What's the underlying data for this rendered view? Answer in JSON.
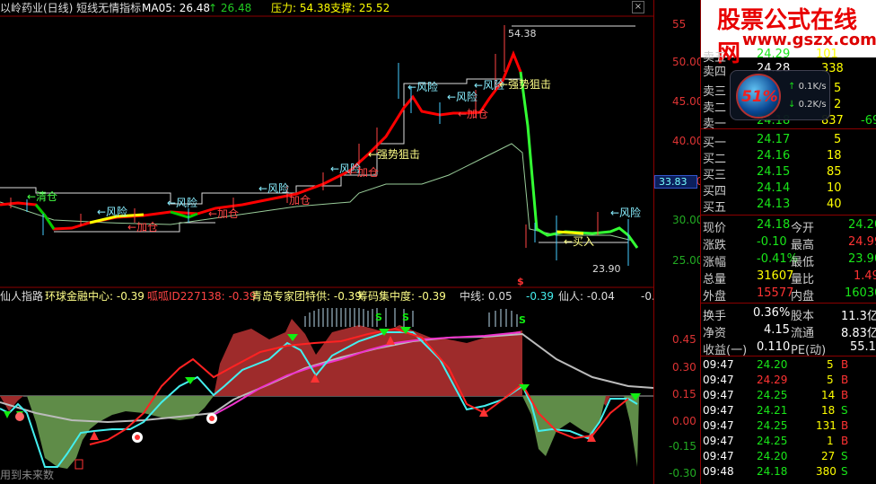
{
  "header": {
    "title": "以岭药业(日线) 短线无情指标",
    "ma_label": "MA05: 26.48",
    "ma_diff": "↑ 26.48",
    "pressure": "压力: 54.38",
    "support": "支撑: 25.52",
    "close_label": "×"
  },
  "main_chart": {
    "annotations": {
      "clear1": "←清仓",
      "risk1": "←风险",
      "add1": "←加仓",
      "risk2": "←风险",
      "add2": "←加仓",
      "risk3": "←风险",
      "add3": "←加仓",
      "add4": "加仓",
      "risk4": "←风险",
      "add5": "←加仓",
      "strong1": "←强势狙击",
      "risk5": "←风险",
      "add6": "←加仓",
      "risk6": "←风险",
      "strong2": "←强势狙击",
      "high": "54.38",
      "low": "23.90",
      "buy": "←买入",
      "risk7": "←风险",
      "s_mark": "S"
    },
    "price_ticks": [
      "55",
      "50.00",
      "45.00",
      "40.00",
      "35.00",
      "30.00",
      "25.00"
    ],
    "current_price_badge": "33.83"
  },
  "sub_chart": {
    "label": "仙人指路",
    "items": [
      {
        "name": "环球金融中心",
        "value": "-0.39"
      },
      {
        "name": "呱呱ID227138",
        "value": "-0.39"
      },
      {
        "name": "青岛专家团特供",
        "value": "-0.39"
      },
      {
        "name": "筹码集中度",
        "value": "-0.39"
      },
      {
        "name": "中线",
        "value": "0.05"
      },
      {
        "name": "",
        "value": "-0.39"
      },
      {
        "name": "仙人",
        "value": "-0.04"
      },
      {
        "name": "",
        "value": "-0."
      }
    ],
    "ticks": [
      "0.45",
      "0.30",
      "0.15",
      "0.00",
      "-0.15",
      "-0.30"
    ],
    "footer": "用到未来数"
  },
  "quote_panel": {
    "banner_title": "股票公式在线网",
    "banner_url": "www.gszx.com.cn",
    "asks": [
      {
        "label": "卖五",
        "price": "24.29",
        "vol": "101"
      },
      {
        "label": "卖四",
        "price": "24.28",
        "vol": "338"
      },
      {
        "label": "卖三",
        "price": "",
        "vol": "5"
      },
      {
        "label": "卖二",
        "price": "",
        "vol": "2"
      },
      {
        "label": "卖一",
        "price": "24.18",
        "vol": "837",
        "extra": "-69"
      }
    ],
    "bids": [
      {
        "label": "买一",
        "price": "24.17",
        "vol": "5"
      },
      {
        "label": "买二",
        "price": "24.16",
        "vol": "18"
      },
      {
        "label": "买三",
        "price": "24.15",
        "vol": "85"
      },
      {
        "label": "买四",
        "price": "24.14",
        "vol": "10"
      },
      {
        "label": "买五",
        "price": "24.13",
        "vol": "40"
      }
    ],
    "stats": [
      {
        "l1": "现价",
        "v1": "24.18",
        "l2": "今开",
        "v2": "24.20",
        "c1": "green",
        "c2": "green"
      },
      {
        "l1": "涨跌",
        "v1": "-0.10",
        "l2": "最高",
        "v2": "24.99",
        "c1": "green",
        "c2": "red"
      },
      {
        "l1": "涨幅",
        "v1": "-0.41%",
        "l2": "最低",
        "v2": "23.90",
        "c1": "green",
        "c2": "green"
      },
      {
        "l1": "总量",
        "v1": "31607",
        "l2": "量比",
        "v2": "1.49",
        "c1": "yel",
        "c2": "red"
      },
      {
        "l1": "外盘",
        "v1": "15577",
        "l2": "内盘",
        "v2": "16030",
        "c1": "red",
        "c2": "green"
      }
    ],
    "fund": [
      {
        "l1": "换手",
        "v1": "0.36%",
        "l2": "股本",
        "v2": "11.3亿"
      },
      {
        "l1": "净资",
        "v1": "4.15",
        "l2": "流通",
        "v2": "8.83亿"
      },
      {
        "l1": "收益(一)",
        "v1": "0.110",
        "l2": "PE(动)",
        "v2": "55.1"
      }
    ],
    "speed_widget": {
      "percent": "51%",
      "up": "0.1K/s",
      "down": "0.2K/s"
    },
    "trades": [
      {
        "time": "09:47",
        "price": "24.20",
        "vol": "5",
        "bs": "B",
        "pc": "green"
      },
      {
        "time": "09:47",
        "price": "24.29",
        "vol": "5",
        "bs": "B",
        "pc": "red"
      },
      {
        "time": "09:47",
        "price": "24.25",
        "vol": "14",
        "bs": "B",
        "pc": "green"
      },
      {
        "time": "09:47",
        "price": "24.21",
        "vol": "18",
        "bs": "S",
        "pc": "green"
      },
      {
        "time": "09:47",
        "price": "24.25",
        "vol": "131",
        "bs": "B",
        "pc": "green"
      },
      {
        "time": "09:47",
        "price": "24.25",
        "vol": "1",
        "bs": "B",
        "pc": "green"
      },
      {
        "time": "09:47",
        "price": "24.20",
        "vol": "27",
        "bs": "S",
        "pc": "green"
      },
      {
        "time": "09:48",
        "price": "24.18",
        "vol": "380",
        "bs": "S",
        "pc": "green"
      }
    ]
  }
}
